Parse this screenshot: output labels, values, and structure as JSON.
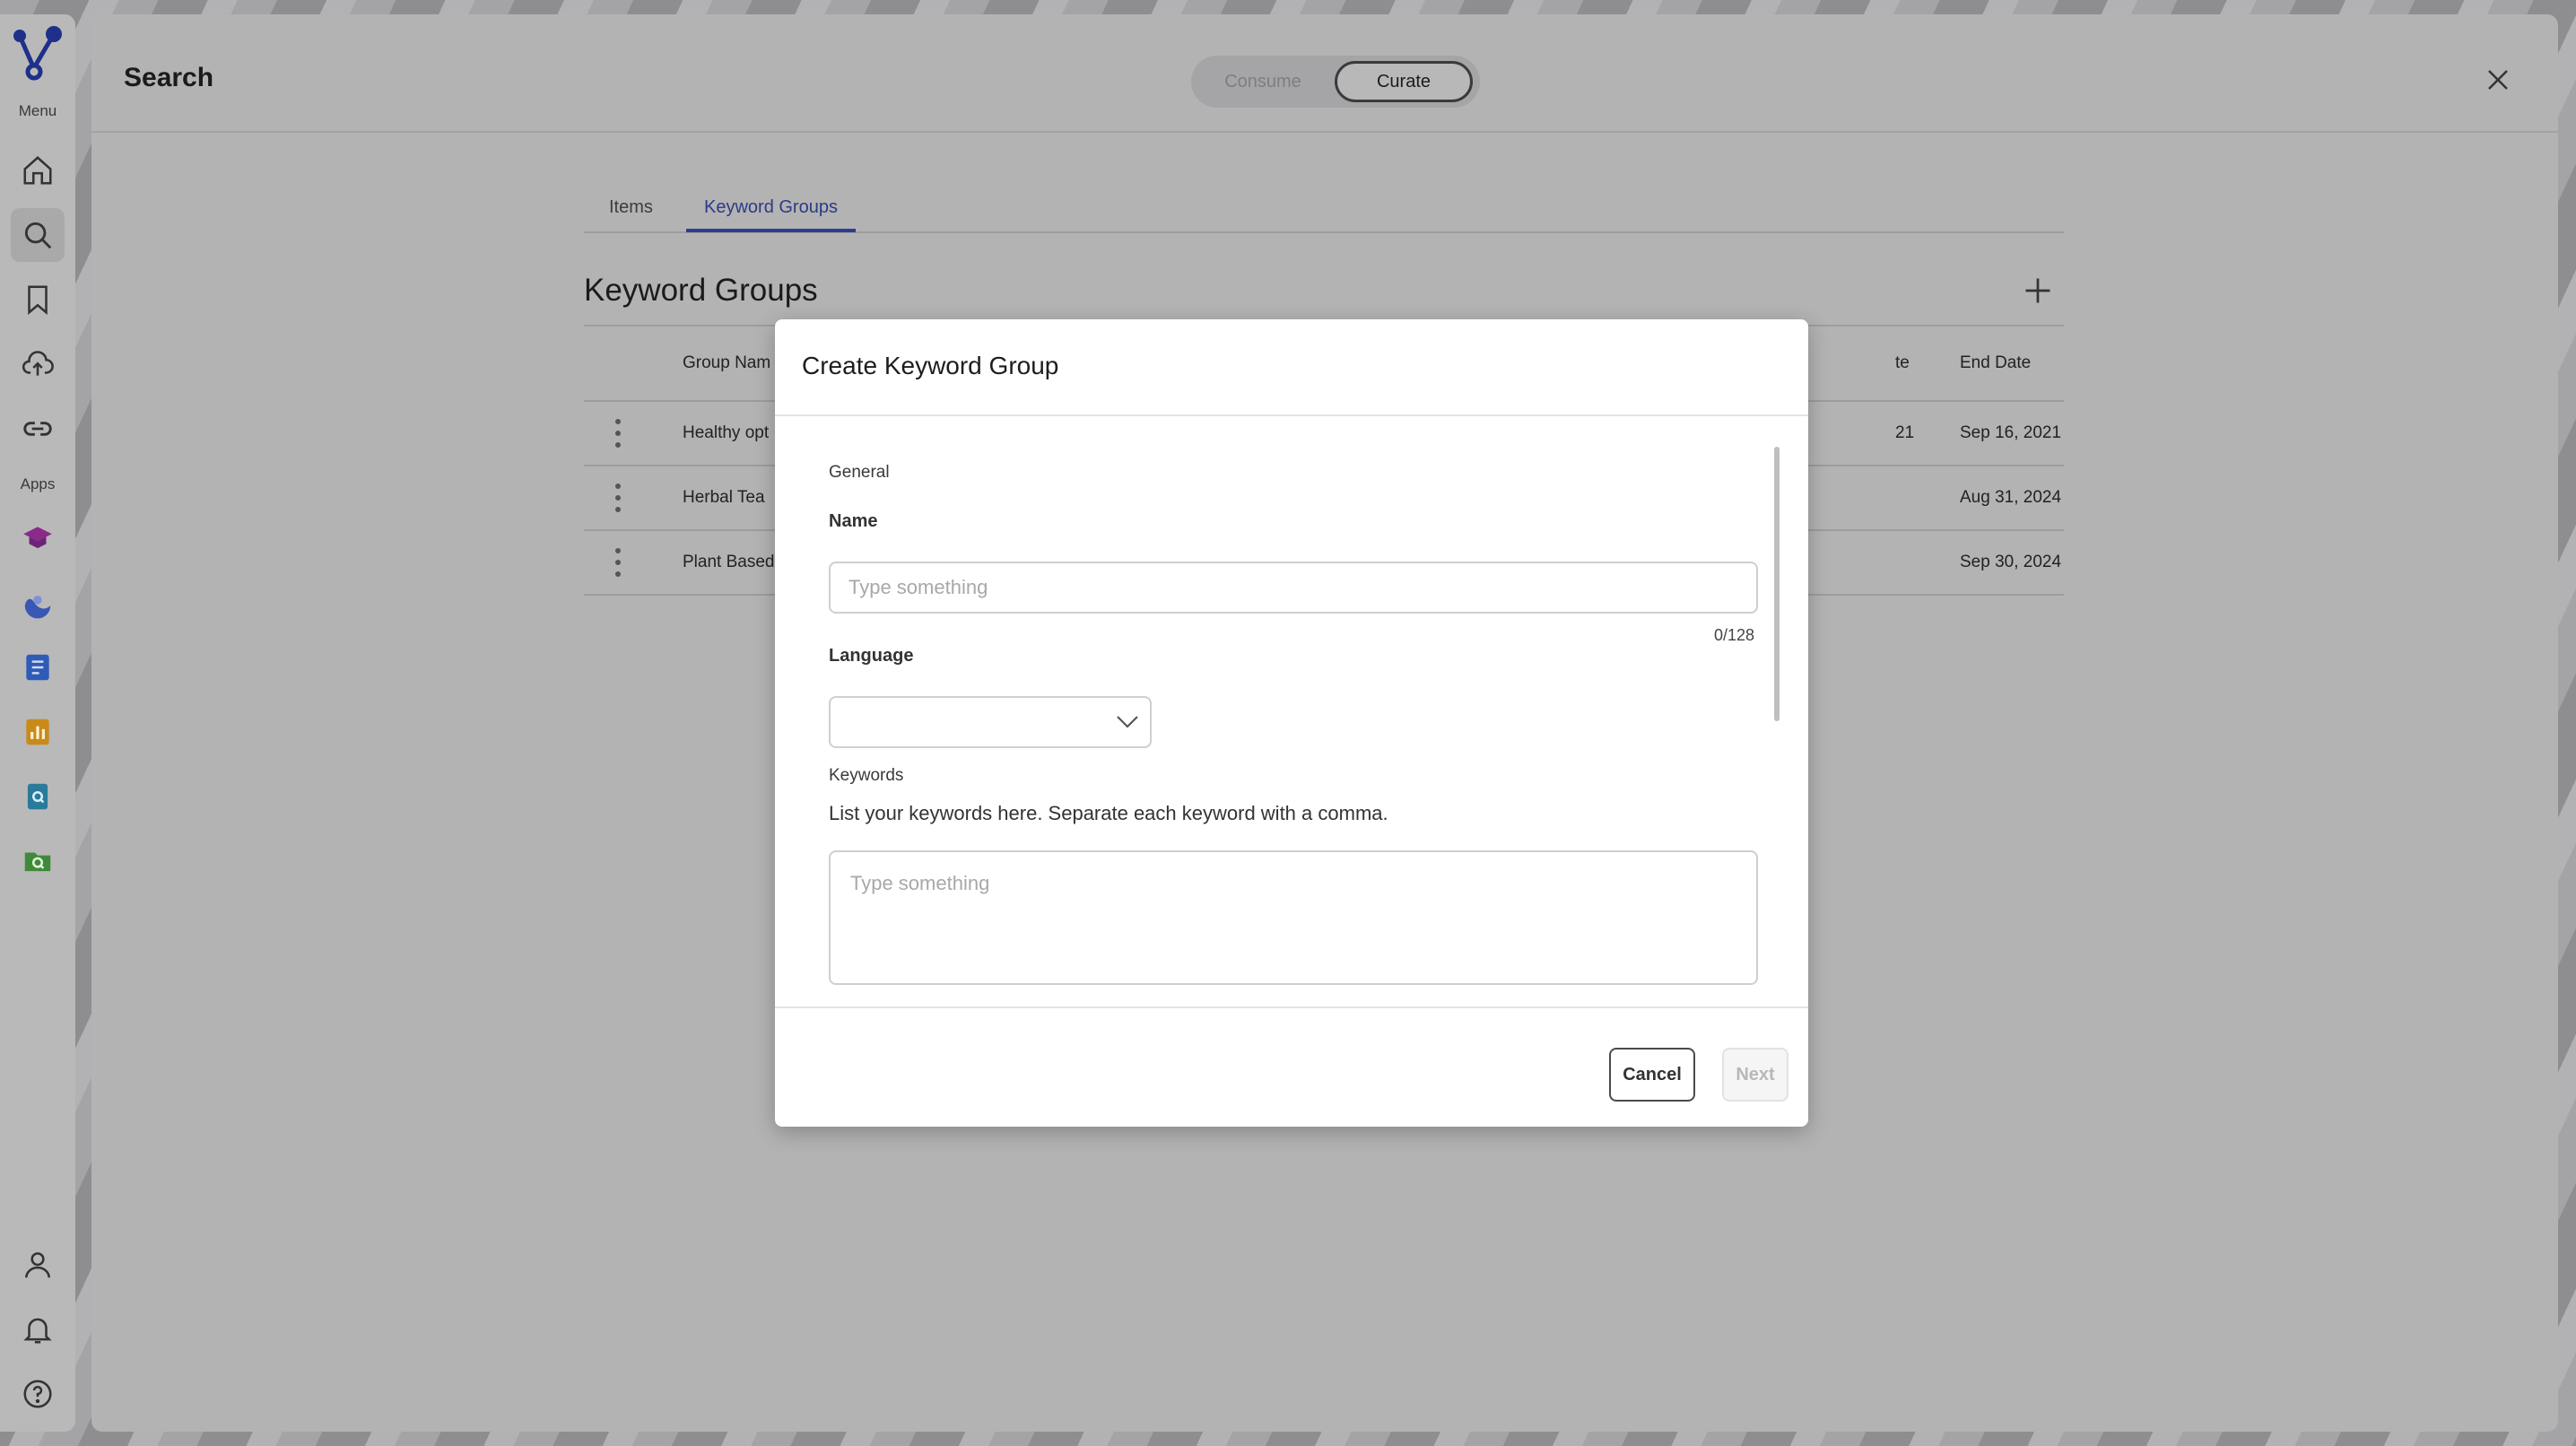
{
  "rail": {
    "menu_label": "Menu",
    "apps_label": "Apps",
    "nav": [
      "home-icon",
      "search-icon",
      "bookmark-icon",
      "upload-cloud-icon",
      "link-icon"
    ],
    "apps": [
      "graduation-cap-icon",
      "wave-icon",
      "document-list-icon",
      "bar-chart-icon",
      "search-document-icon",
      "search-folder-icon"
    ],
    "bottom": [
      "user-icon",
      "bell-icon",
      "help-icon"
    ]
  },
  "header": {
    "title": "Search",
    "mode_options": [
      "Consume",
      "Curate"
    ],
    "selected_mode": "Curate"
  },
  "tabs": [
    {
      "label": "Items"
    },
    {
      "label": "Keyword Groups"
    }
  ],
  "section": {
    "title": "Keyword Groups"
  },
  "table": {
    "columns": [
      "Group Nam",
      "te",
      "End Date"
    ],
    "rows": [
      {
        "name": "Healthy opt",
        "start_partial": "21",
        "end": "Sep 16, 2021"
      },
      {
        "name": "Herbal Tea",
        "start_partial": "",
        "end": "Aug 31, 2024"
      },
      {
        "name": "Plant Based",
        "start_partial": "",
        "end": "Sep 30, 2024"
      }
    ]
  },
  "modal": {
    "title": "Create Keyword Group",
    "general_label": "General",
    "name_label": "Name",
    "name_placeholder": "Type something",
    "name_value": "",
    "name_counter": "0/128",
    "language_label": "Language",
    "language_value": "",
    "keywords_label": "Keywords",
    "keywords_help": "List your keywords here. Separate each keyword with a comma.",
    "keywords_placeholder": "Type something",
    "cancel_label": "Cancel",
    "next_label": "Next"
  },
  "colors": {
    "accent": "#2d3d8e",
    "overlay": "#b3b3b3"
  }
}
